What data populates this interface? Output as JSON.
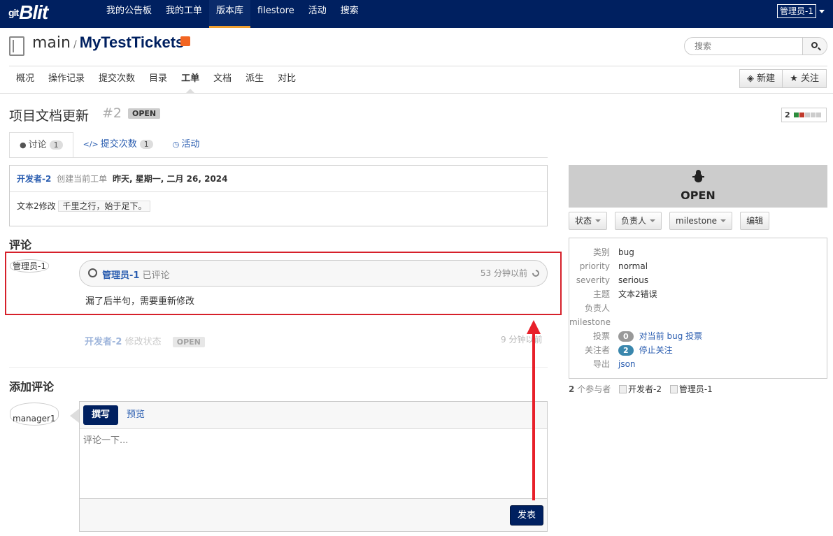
{
  "topbar": {
    "logo_prefix": "git",
    "logo": "Blit",
    "nav": [
      "我的公告板",
      "我的工单",
      "版本库",
      "filestore",
      "活动",
      "搜索"
    ],
    "active_nav": 2,
    "user_avatar_alt": "管理员-1"
  },
  "repo": {
    "group": "main",
    "separator": "/",
    "name": "MyTestTickets",
    "search_placeholder": "搜索"
  },
  "subnav": {
    "items": [
      "概况",
      "操作记录",
      "提交次数",
      "目录",
      "工单",
      "文档",
      "派生",
      "对比"
    ],
    "active": 4,
    "new_label": "新建",
    "watch_label": "关注"
  },
  "ticket": {
    "title": "项目文档更新",
    "number": "#2",
    "status": "OPEN",
    "vote_count": "2"
  },
  "tabs": [
    {
      "label": "讨论",
      "badge": "1"
    },
    {
      "label": "提交次数",
      "badge": "1"
    },
    {
      "label": "活动",
      "badge": ""
    }
  ],
  "description": {
    "author": "开发者-2",
    "action": "创建当前工单",
    "date": "昨天, 星期一, 二月 26, 2024",
    "text": "文本2修改",
    "code": "千里之行，始于足下。"
  },
  "comments": {
    "section_title": "评论",
    "items": [
      {
        "avatar_alt": "管理员-1",
        "author": "管理员-1",
        "action": "已评论",
        "time": "53 分钟以前",
        "text": "漏了后半句，需要重新修改"
      }
    ],
    "status_change": {
      "author": "开发者-2",
      "action": "修改状态",
      "status": "OPEN",
      "time": "9 分钟以前"
    }
  },
  "add_comment": {
    "section_title": "添加评论",
    "avatar_alt": "manager1",
    "write_tab": "撰写",
    "preview_tab": "预览",
    "placeholder": "评论一下...",
    "post_label": "发表"
  },
  "sidebar": {
    "type_status": "OPEN",
    "type_icon": "bug-icon",
    "buttons": [
      "状态",
      "负责人",
      "milestone",
      "编辑"
    ],
    "properties": {
      "type_key": "类别",
      "type_val": "bug",
      "priority_key": "priority",
      "priority_val": "normal",
      "severity_key": "severity",
      "severity_val": "serious",
      "topic_key": "主题",
      "topic_val": "文本2错误",
      "responsible_key": "负责人",
      "responsible_val": "",
      "milestone_key": "milestone",
      "milestone_val": "",
      "votes_key": "投票",
      "votes_count": "0",
      "votes_link": "对当前 bug 投票",
      "watchers_key": "关注者",
      "watchers_count": "2",
      "watchers_link": "停止关注",
      "export_key": "导出",
      "export_link": "json"
    },
    "participants": {
      "count": "2",
      "label": "个参与者",
      "names": [
        "开发者-2",
        "管理员-1"
      ]
    }
  },
  "colors": {
    "navbar": "#002060",
    "accent": "#f0a030",
    "link": "#2a5db0",
    "highlight_border": "#d6202a",
    "arrow": "#e8202a",
    "watchers_badge": "#3a87ad",
    "votes_badge": "#999999"
  }
}
